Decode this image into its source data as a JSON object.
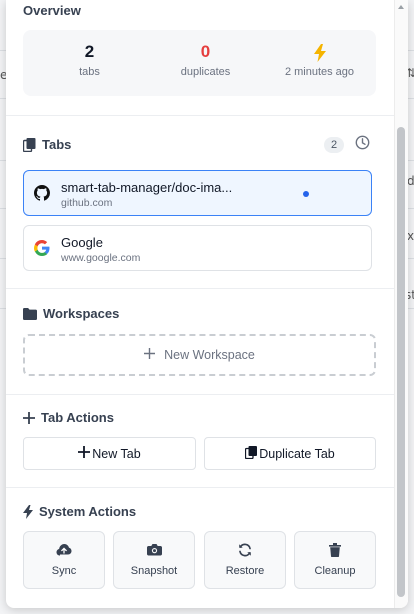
{
  "overview": {
    "title": "Overview",
    "stats": [
      {
        "value": "2",
        "label": "tabs"
      },
      {
        "value": "0",
        "label": "duplicates"
      },
      {
        "icon": "lightning-icon",
        "label": "2 minutes ago"
      }
    ]
  },
  "tabs_section": {
    "title": "Tabs",
    "count": "2",
    "items": [
      {
        "title": "smart-tab-manager/doc-ima...",
        "url": "github.com",
        "favicon": "github-icon",
        "active": true
      },
      {
        "title": "Google",
        "url": "www.google.com",
        "favicon": "google-icon",
        "active": false
      }
    ]
  },
  "workspaces": {
    "title": "Workspaces",
    "new_label": "New Workspace"
  },
  "tab_actions": {
    "title": "Tab Actions",
    "new_tab": "New Tab",
    "duplicate_tab": "Duplicate Tab"
  },
  "system_actions": {
    "title": "System Actions",
    "buttons": [
      {
        "label": "Sync",
        "icon": "cloud-upload-icon"
      },
      {
        "label": "Snapshot",
        "icon": "camera-icon"
      },
      {
        "label": "Restore",
        "icon": "refresh-icon"
      },
      {
        "label": "Cleanup",
        "icon": "trash-icon"
      }
    ]
  },
  "colors": {
    "accent": "#3b82f6",
    "active_tab_bg": "#eff6ff",
    "duplicates_red": "#e53e3e",
    "bolt_yellow": "#f5b400"
  },
  "background_glyphs": [
    "e",
    "⇅",
    "d",
    "x",
    "st"
  ]
}
